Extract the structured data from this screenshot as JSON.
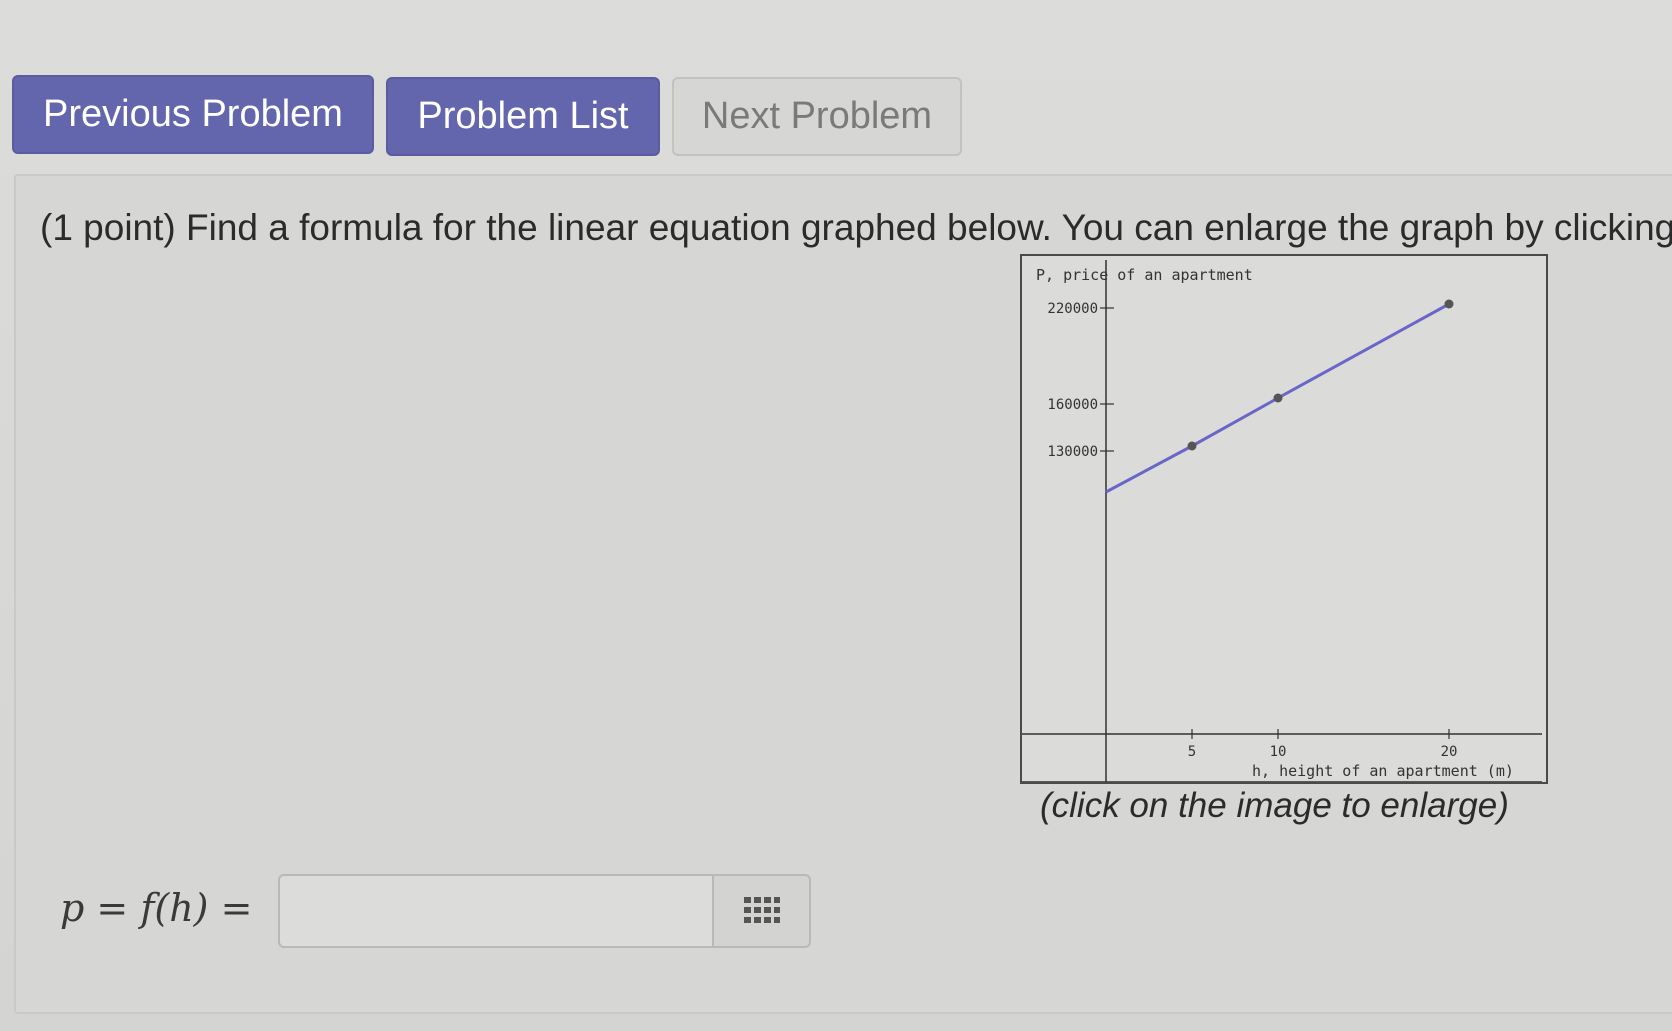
{
  "nav": {
    "previous_label": "Previous Problem",
    "list_label": "Problem List",
    "next_label": "Next Problem"
  },
  "problem": {
    "statement": "(1 point) Find a formula for the linear equation graphed below. You can enlarge the graph by clicking",
    "caption": "(click on the image to enlarge)",
    "formula_label": "p = f(h) =",
    "answer_value": "",
    "keypad_icon": "grid-keypad-icon"
  },
  "chart_data": {
    "type": "line",
    "ylabel": "P, price of an apartment",
    "xlabel": "h, height of an apartment (m)",
    "x_ticks": [
      "5",
      "10",
      "20"
    ],
    "y_ticks": [
      "220000",
      "160000",
      "130000"
    ],
    "series": [
      {
        "x": [
          0,
          5,
          10,
          20
        ],
        "y": [
          102000,
          130000,
          158000,
          220000
        ],
        "marked_points": [
          5,
          10,
          20
        ]
      }
    ],
    "line_color": "#6a66c8"
  }
}
